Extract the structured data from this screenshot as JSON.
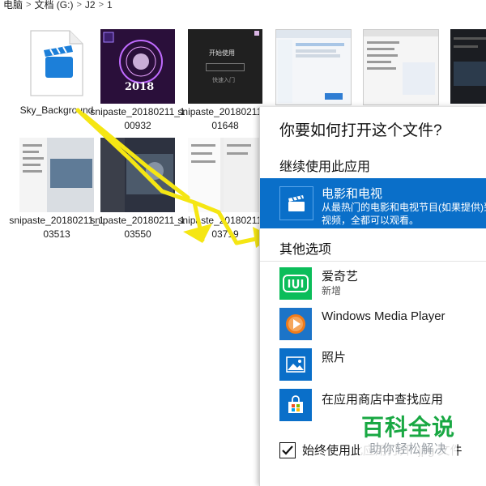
{
  "breadcrumb": {
    "items": [
      "电脑",
      "文档 (G:)",
      "J2",
      "1"
    ],
    "separator": ">"
  },
  "files": [
    {
      "label": "Sky_Background"
    },
    {
      "label": "snipaste_20180211_100932"
    },
    {
      "label": "snipaste_20180211_101648"
    },
    {
      "label": ""
    },
    {
      "label": ""
    },
    {
      "label": ""
    },
    {
      "label": "snipaste_20180211_103513"
    },
    {
      "label": "snipaste_20180211_103550"
    },
    {
      "label": "snipaste_20180211_103719"
    }
  ],
  "thumbs": {
    "thumb2_text": "2018",
    "thumb3_text1": "开始使用",
    "thumb3_text2": "快速入门"
  },
  "dialog": {
    "title": "你要如何打开这个文件?",
    "continue_heading": "继续使用此应用",
    "selected_app": {
      "name": "电影和电视",
      "desc_line1": "从最热门的电影和电视节目(如果提供)到",
      "desc_line2": "视频，全都可以观看。",
      "icon": "clapperboard-icon"
    },
    "other_heading": "其他选项",
    "apps": [
      {
        "name": "爱奇艺",
        "sub": "新增",
        "icon": "iqiyi-icon",
        "color": "#0bbd5a"
      },
      {
        "name": "Windows Media Player",
        "sub": "",
        "icon": "media-player-icon",
        "color": "#1c74c8"
      },
      {
        "name": "照片",
        "sub": "",
        "icon": "photos-icon",
        "color": "#0a6fc9"
      },
      {
        "name": "在应用商店中查找应用",
        "sub": "",
        "icon": "store-icon",
        "color": "#0a6fc9"
      }
    ],
    "always_use_label": "始终使用此应用打开 .jpg 文件",
    "always_use_checked": true
  },
  "watermark": {
    "main": "百科全说",
    "sub": "助你轻松解决"
  },
  "colors": {
    "accent": "#0a6fc9",
    "annotation_arrow": "#f5e613",
    "watermark_green": "#19a843"
  }
}
